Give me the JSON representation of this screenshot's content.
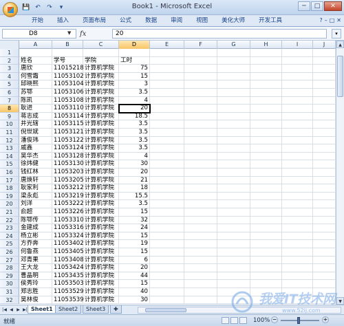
{
  "window": {
    "title": "Book1 - Microsoft Excel",
    "controls": [
      "─",
      "□",
      "✕"
    ]
  },
  "qat": [
    "💾",
    "↶",
    "↷",
    "▾"
  ],
  "ribbon": {
    "tabs": [
      "开始",
      "插入",
      "页面布局",
      "公式",
      "数据",
      "审阅",
      "视图",
      "美化大师",
      "开发工具"
    ],
    "right": [
      "?",
      "–",
      "□",
      "✕"
    ]
  },
  "formula_bar": {
    "name_box": "D8",
    "fx": "fx",
    "value": "20"
  },
  "columns": [
    "A",
    "B",
    "C",
    "D",
    "E",
    "F",
    "G",
    "H",
    "I",
    "J"
  ],
  "selected_column": "D",
  "selected_row": 8,
  "rows": [
    {
      "n": 1,
      "a": "",
      "b": "",
      "c": "",
      "d": ""
    },
    {
      "n": 2,
      "a": "姓名",
      "b": "学号",
      "c": "学院",
      "d": "工时"
    },
    {
      "n": 3,
      "a": "唐欣",
      "b": "11015218",
      "c": "计算机学院",
      "d": "75"
    },
    {
      "n": 4,
      "a": "何雪霜",
      "b": "11053102",
      "c": "计算机学院",
      "d": "15"
    },
    {
      "n": 5,
      "a": "邱晓熙",
      "b": "11053104",
      "c": "计算机学院",
      "d": "3"
    },
    {
      "n": 6,
      "a": "苏鄂",
      "b": "11053106",
      "c": "计算机学院",
      "d": "3.5"
    },
    {
      "n": 7,
      "a": "陈凯",
      "b": "11053108",
      "c": "计算机学院",
      "d": "4"
    },
    {
      "n": 8,
      "a": "耿进",
      "b": "11053110",
      "c": "计算机学院",
      "d": "20"
    },
    {
      "n": 9,
      "a": "蒋志成",
      "b": "11053114",
      "c": "计算机学院",
      "d": "18.5"
    },
    {
      "n": 10,
      "a": "井光辖",
      "b": "11053115",
      "c": "计算机学院",
      "d": "3.5"
    },
    {
      "n": 11,
      "a": "倪世斌",
      "b": "11053121",
      "c": "计算机学院",
      "d": "3.5"
    },
    {
      "n": 12,
      "a": "潘俊玮",
      "b": "11053122",
      "c": "计算机学院",
      "d": "3.5"
    },
    {
      "n": 13,
      "a": "戚鑫",
      "b": "11053124",
      "c": "计算机学院",
      "d": "3.5"
    },
    {
      "n": 14,
      "a": "吴华杰",
      "b": "11053128",
      "c": "计算机学院",
      "d": "4"
    },
    {
      "n": 15,
      "a": "徐炜健",
      "b": "11053130",
      "c": "计算机学院",
      "d": "30"
    },
    {
      "n": 16,
      "a": "钱红林",
      "b": "11053203",
      "c": "计算机学院",
      "d": "20"
    },
    {
      "n": 17,
      "a": "唐焕轩",
      "b": "11053205",
      "c": "计算机学院",
      "d": "21"
    },
    {
      "n": 18,
      "a": "耿家利",
      "b": "11053212",
      "c": "计算机学院",
      "d": "18"
    },
    {
      "n": 19,
      "a": "梁永彪",
      "b": "11053219",
      "c": "计算机学院",
      "d": "15.5"
    },
    {
      "n": 20,
      "a": "刘洋",
      "b": "11053222",
      "c": "计算机学院",
      "d": "3.5"
    },
    {
      "n": 21,
      "a": "俞超",
      "b": "11053226",
      "c": "计算机学院",
      "d": "15"
    },
    {
      "n": 22,
      "a": "陈鄂传",
      "b": "11053310",
      "c": "计算机学院",
      "d": "32"
    },
    {
      "n": 23,
      "a": "金建成",
      "b": "11053316",
      "c": "计算机学院",
      "d": "24"
    },
    {
      "n": 24,
      "a": "杨立彬",
      "b": "11053324",
      "c": "计算机学院",
      "d": "15"
    },
    {
      "n": 25,
      "a": "方乔奔",
      "b": "11053402",
      "c": "计算机学院",
      "d": "19"
    },
    {
      "n": 26,
      "a": "何鲁燕",
      "b": "11053405",
      "c": "计算机学院",
      "d": "15"
    },
    {
      "n": 27,
      "a": "邓青果",
      "b": "11053408",
      "c": "计算机学院",
      "d": "6"
    },
    {
      "n": 28,
      "a": "王大龙",
      "b": "11053424",
      "c": "计算机学院",
      "d": "20"
    },
    {
      "n": 29,
      "a": "曹晶明",
      "b": "11053435",
      "c": "计算机学院",
      "d": "44"
    },
    {
      "n": 30,
      "a": "侯秀玲",
      "b": "11053503",
      "c": "计算机学院",
      "d": "15"
    },
    {
      "n": 31,
      "a": "郑志胜",
      "b": "11053529",
      "c": "计算机学院",
      "d": "40"
    },
    {
      "n": 32,
      "a": "吴林俊",
      "b": "11053539",
      "c": "计算机学院",
      "d": "30"
    }
  ],
  "sheets": [
    "Sheet1",
    "Sheet2",
    "Sheet3"
  ],
  "active_sheet": "Sheet1",
  "status": {
    "ready": "就绪",
    "zoom": "100%"
  },
  "watermark": {
    "text": "我爱IT技术网",
    "url": "www.52ij.com"
  }
}
